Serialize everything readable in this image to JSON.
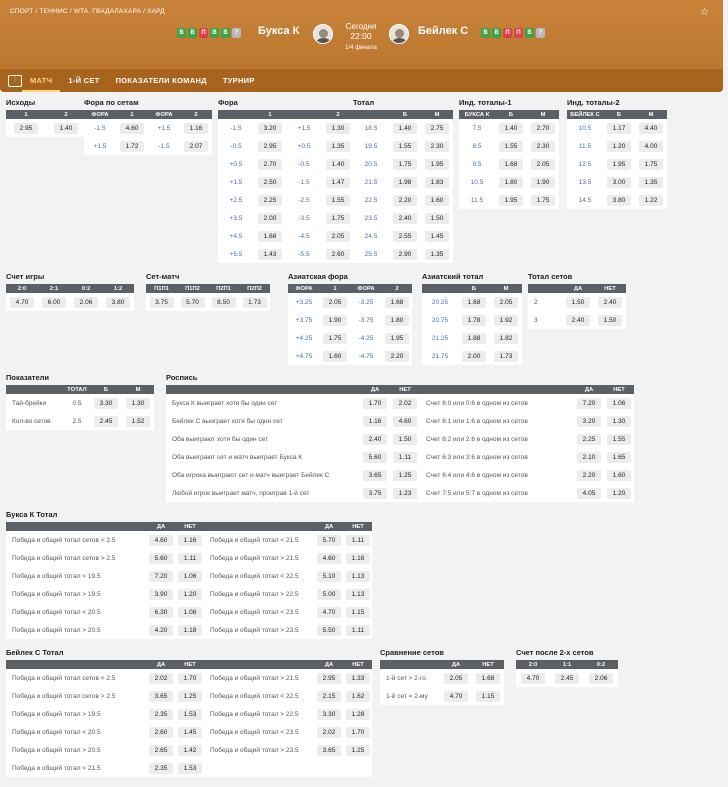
{
  "breadcrumb": "СПОРТ / ТЕННИС / WTA. ГВАДАЛАХАРА / ХАРД",
  "match": {
    "home": "Букса К",
    "away": "Бейлек С",
    "date": "Сегодня",
    "time": "22:00",
    "round": "1/4 финала",
    "home_form": [
      "В",
      "В",
      "П",
      "В",
      "В",
      "?"
    ],
    "away_form": [
      "В",
      "В",
      "П",
      "П",
      "В",
      "?"
    ]
  },
  "tabs": [
    "МАТЧ",
    "1-Й СЕТ",
    "ПОКАЗАТЕЛИ КОМАНД",
    "ТУРНИР"
  ],
  "outcomes": {
    "title": "Исходы",
    "headers": [
      "1",
      "2"
    ],
    "rows": [
      [
        "2.95",
        "1.40"
      ]
    ]
  },
  "set_handicap": {
    "title": "Фора по сетам",
    "headers": [
      "ФОРА",
      "1",
      "ФОРА",
      "2"
    ],
    "rows": [
      [
        "-1.5",
        "4.60",
        "+1.5",
        "1.16"
      ],
      [
        "+1.5",
        "1.72",
        "-1.5",
        "2.07"
      ]
    ]
  },
  "handicap": {
    "title": "Фора",
    "headers": [
      "1",
      "2"
    ],
    "rows": [
      [
        "-1.5",
        "3.20",
        "+1.5",
        "1.30"
      ],
      [
        "-0.5",
        "2.95",
        "+0.5",
        "1.35"
      ],
      [
        "+0.5",
        "2.70",
        "-0.5",
        "1.40"
      ],
      [
        "+1.5",
        "2.50",
        "-1.5",
        "1.47"
      ],
      [
        "+2.5",
        "2.25",
        "-2.5",
        "1.55"
      ],
      [
        "+3.5",
        "2.00",
        "-3.5",
        "1.75"
      ],
      [
        "+4.5",
        "1.68",
        "-4.5",
        "2.05"
      ],
      [
        "+5.5",
        "1.43",
        "-5.5",
        "2.60"
      ]
    ]
  },
  "total": {
    "title": "Тотал",
    "headers": [
      "Б",
      "М"
    ],
    "rows": [
      [
        "18.5",
        "1.40",
        "2.75"
      ],
      [
        "19.5",
        "1.55",
        "2.30"
      ],
      [
        "20.5",
        "1.75",
        "1.95"
      ],
      [
        "21.5",
        "1.98",
        "1.83"
      ],
      [
        "22.5",
        "2.20",
        "1.60"
      ],
      [
        "23.5",
        "2.40",
        "1.50"
      ],
      [
        "24.5",
        "2.55",
        "1.45"
      ],
      [
        "25.5",
        "2.90",
        "1.35"
      ]
    ]
  },
  "ind_total_1": {
    "title": "Инд. тоталы-1",
    "headers": [
      "БУКСА К",
      "Б",
      "М"
    ],
    "rows": [
      [
        "7.5",
        "1.40",
        "2.70"
      ],
      [
        "8.5",
        "1.55",
        "2.30"
      ],
      [
        "9.5",
        "1.68",
        "2.05"
      ],
      [
        "10.5",
        "1.80",
        "1.90"
      ],
      [
        "11.5",
        "1.95",
        "1.75"
      ]
    ]
  },
  "ind_total_2": {
    "title": "Инд. тоталы-2",
    "headers": [
      "БЕЙЛЕК С",
      "Б",
      "М"
    ],
    "rows": [
      [
        "10.5",
        "1.17",
        "4.40"
      ],
      [
        "11.5",
        "1.20",
        "4.00"
      ],
      [
        "12.5",
        "1.95",
        "1.75"
      ],
      [
        "13.5",
        "3.00",
        "1.35"
      ],
      [
        "14.5",
        "3.80",
        "1.22"
      ]
    ]
  },
  "game_score": {
    "title": "Счет игры",
    "headers": [
      "2:0",
      "2:1",
      "0:2",
      "1:2"
    ],
    "rows": [
      [
        "4.70",
        "6.00",
        "2.06",
        "3.80"
      ]
    ]
  },
  "set_match": {
    "title": "Сет-матч",
    "headers": [
      "П1П1",
      "П1П2",
      "П2П1",
      "П2П2"
    ],
    "rows": [
      [
        "3.75",
        "5.70",
        "8.50",
        "1.73"
      ]
    ]
  },
  "asian_handicap": {
    "title": "Азиатская фора",
    "headers": [
      "ФОРА",
      "1",
      "ФОРА",
      "2"
    ],
    "rows": [
      [
        "+3.25",
        "2.05",
        "-3.25",
        "1.68"
      ],
      [
        "+3.75",
        "1.90",
        "-3.75",
        "1.80"
      ],
      [
        "+4.25",
        "1.75",
        "-4.25",
        "1.95"
      ],
      [
        "+4.75",
        "1.60",
        "-4.75",
        "2.20"
      ]
    ]
  },
  "asian_total": {
    "title": "Азиатский тотал",
    "headers": [
      "Б",
      "М"
    ],
    "rows": [
      [
        "20.25",
        "1.68",
        "2.05"
      ],
      [
        "20.75",
        "1.78",
        "1.92"
      ],
      [
        "21.25",
        "1.88",
        "1.82"
      ],
      [
        "21.75",
        "2.00",
        "1.73"
      ]
    ]
  },
  "set_total": {
    "title": "Тотал сетов",
    "headers": [
      "ДА",
      "НЕТ"
    ],
    "rows": [
      [
        "2",
        "1.50",
        "2.40"
      ],
      [
        "3",
        "2.40",
        "1.50"
      ]
    ]
  },
  "stats": {
    "title": "Показатели",
    "headers": [
      "ТОТАЛ",
      "Б",
      "М"
    ],
    "rows": [
      [
        "Тай-брейки",
        "0.5",
        "3.30",
        "1.30"
      ],
      [
        "Кол-во сетов",
        "2.5",
        "2.45",
        "1.52"
      ]
    ]
  },
  "specials": {
    "title": "Роспись",
    "headers": [
      "ДА",
      "НЕТ",
      "ДА",
      "НЕТ"
    ],
    "rows": [
      [
        "Букса К выиграет хотя бы один сет",
        "1.70",
        "2.02",
        "Счет 6:0 или 0:6 в одном из сетов",
        "7.20",
        "1.06"
      ],
      [
        "Бейлек С выиграет хотя бы один сет",
        "1.16",
        "4.60",
        "Счет 6:1 или 1:6 в одном из сетов",
        "3.20",
        "1.30"
      ],
      [
        "Оба выиграют хотя бы один сет",
        "2.40",
        "1.50",
        "Счет 6:2 или 2:6 в одном из сетов",
        "2.25",
        "1.55"
      ],
      [
        "Оба выиграют сет и матч выиграет Букса К",
        "5.60",
        "1.11",
        "Счет 6:3 или 3:6 в одном из сетов",
        "2.10",
        "1.65"
      ],
      [
        "Оба игрока выиграют сет и матч выиграет Бейлек С",
        "3.65",
        "1.25",
        "Счет 6:4 или 4:6 в одном из сетов",
        "2.20",
        "1.60"
      ],
      [
        "Любой игрок выиграет матч, проиграв 1-й сет",
        "3.75",
        "1.23",
        "Счет 7:5 или 5:7 в одном из сетов",
        "4.05",
        "1.20"
      ]
    ]
  },
  "buksa_total": {
    "title": "Букса К Тотал",
    "headers": [
      "ДА",
      "НЕТ",
      "ДА",
      "НЕТ"
    ],
    "rows": [
      [
        "Победа и общий тотал сетов < 2.5",
        "4.60",
        "1.16",
        "Победа и общий тотал < 21.5",
        "5.70",
        "1.11"
      ],
      [
        "Победа и общий тотал сетов > 2.5",
        "5.60",
        "1.11",
        "Победа и общий тотал > 21.5",
        "4.60",
        "1.16"
      ],
      [
        "Победа и общий тотал < 19.5",
        "7.20",
        "1.06",
        "Победа и общий тотал < 22.5",
        "5.10",
        "1.13"
      ],
      [
        "Победа и общий тотал > 19.5",
        "3.90",
        "1.20",
        "Победа и общий тотал > 22.5",
        "5.00",
        "1.13"
      ],
      [
        "Победа и общий тотал < 20.5",
        "6.30",
        "1.08",
        "Победа и общий тотал < 23.5",
        "4.70",
        "1.15"
      ],
      [
        "Победа и общий тотал > 20.5",
        "4.20",
        "1.18",
        "Победа и общий тотал > 23.5",
        "5.50",
        "1.11"
      ]
    ]
  },
  "beylek_total": {
    "title": "Бейлек С Тотал",
    "headers": [
      "ДА",
      "НЕТ",
      "ДА",
      "НЕТ"
    ],
    "rows": [
      [
        "Победа и общий тотал сетов < 2.5",
        "2.02",
        "1.70",
        "Победа и общий тотал > 21.5",
        "2.95",
        "1.33"
      ],
      [
        "Победа и общий тотал сетов > 2.5",
        "3.65",
        "1.25",
        "Победа и общий тотал < 22.5",
        "2.15",
        "1.62"
      ],
      [
        "Победа и общий тотал > 19.5",
        "2.35",
        "1.53",
        "Победа и общий тотал > 22.5",
        "3.30",
        "1.28"
      ],
      [
        "Победа и общий тотал < 20.5",
        "2.60",
        "1.45",
        "Победа и общий тотал < 23.5",
        "2.02",
        "1.70"
      ],
      [
        "Победа и общий тотал > 20.5",
        "2.65",
        "1.42",
        "Победа и общий тотал > 23.5",
        "3.65",
        "1.25"
      ],
      [
        "Победа и общий тотал < 21.5",
        "2.35",
        "1.53",
        "",
        null,
        null
      ]
    ]
  },
  "set_compare": {
    "title": "Сравнение сетов",
    "headers": [
      "ДА",
      "НЕТ"
    ],
    "rows": [
      [
        "1-й сет > 2-го",
        "2.05",
        "1.68"
      ],
      [
        "1-й сет = 2-му",
        "4.70",
        "1.15"
      ]
    ]
  },
  "after_two_sets": {
    "title": "Счет после 2-х сетов",
    "headers": [
      "2:0",
      "1:1",
      "0:2"
    ],
    "rows": [
      [
        "4.70",
        "2.45",
        "2.06"
      ]
    ]
  }
}
